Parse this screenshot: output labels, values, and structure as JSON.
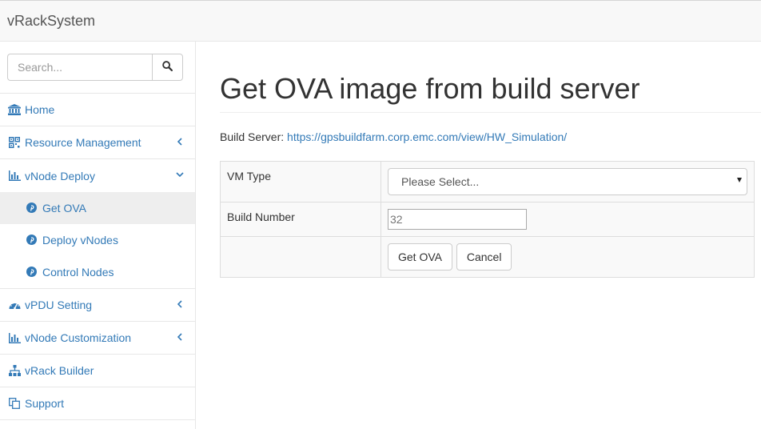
{
  "app": {
    "brand": "vRackSystem"
  },
  "search": {
    "placeholder": "Search..."
  },
  "sidebar": {
    "items": [
      {
        "label": "Home"
      },
      {
        "label": "Resource Management"
      },
      {
        "label": "vNode Deploy"
      },
      {
        "label": "vPDU Setting"
      },
      {
        "label": "vNode Customization"
      },
      {
        "label": "vRack Builder"
      },
      {
        "label": "Support"
      }
    ],
    "vnode_deploy_sub": [
      {
        "label": "Get OVA",
        "active": true
      },
      {
        "label": "Deploy vNodes"
      },
      {
        "label": "Control Nodes"
      }
    ]
  },
  "main": {
    "title": "Get OVA image from build server",
    "build_server_label": "Build Server:",
    "build_server_url": "https://gpsbuildfarm.corp.emc.com/view/HW_Simulation/",
    "form": {
      "vm_type_label": "VM Type",
      "vm_type_value": "Please Select...",
      "build_number_label": "Build Number",
      "build_number_value": "32",
      "get_ova_button": "Get OVA",
      "cancel_button": "Cancel"
    }
  },
  "colors": {
    "link": "#337ab7",
    "navbar_bg": "#f8f8f8",
    "active_bg": "#eeeeee"
  }
}
